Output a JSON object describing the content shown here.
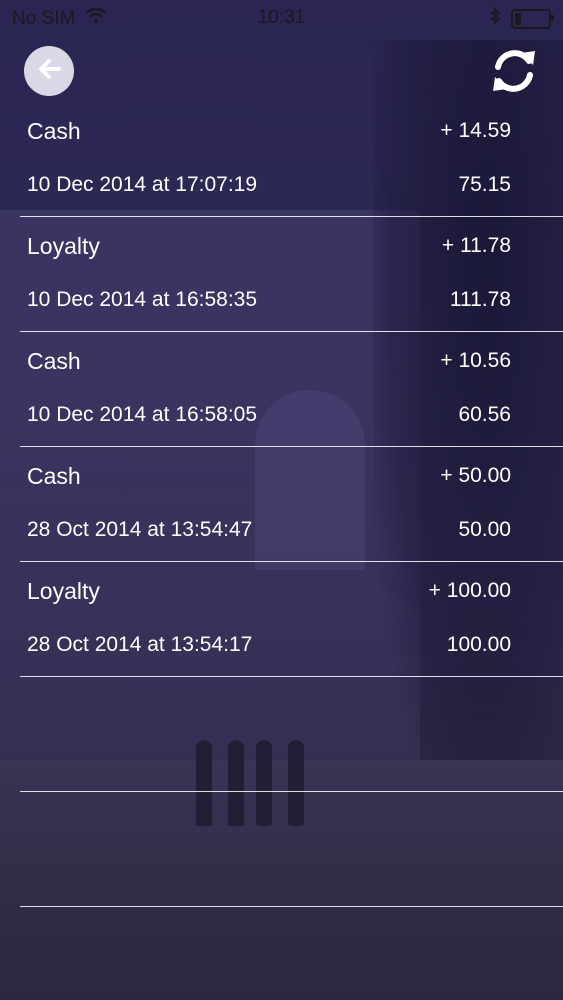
{
  "status_bar": {
    "carrier": "No SIM",
    "time": "10:31",
    "icons": [
      "wifi-icon",
      "bluetooth-icon",
      "battery-icon"
    ],
    "battery_level": 0.2
  },
  "header": {
    "back_icon": "arrow-left-icon",
    "refresh_icon": "refresh-icon"
  },
  "transactions": [
    {
      "type": "Cash",
      "amount": "+ 14.59",
      "date": "10 Dec 2014 at 17:07:19",
      "balance": "75.15"
    },
    {
      "type": "Loyalty",
      "amount": "+ 11.78",
      "date": "10 Dec 2014 at 16:58:35",
      "balance": "111.78"
    },
    {
      "type": "Cash",
      "amount": "+ 10.56",
      "date": "10 Dec 2014 at 16:58:05",
      "balance": "60.56"
    },
    {
      "type": "Cash",
      "amount": "+ 50.00",
      "date": "28 Oct 2014 at 13:54:47",
      "balance": "50.00"
    },
    {
      "type": "Loyalty",
      "amount": "+ 100.00",
      "date": "28 Oct 2014 at 13:54:17",
      "balance": "100.00"
    }
  ],
  "colors": {
    "accent_text": "#ffffff",
    "background": "#2a2553"
  }
}
